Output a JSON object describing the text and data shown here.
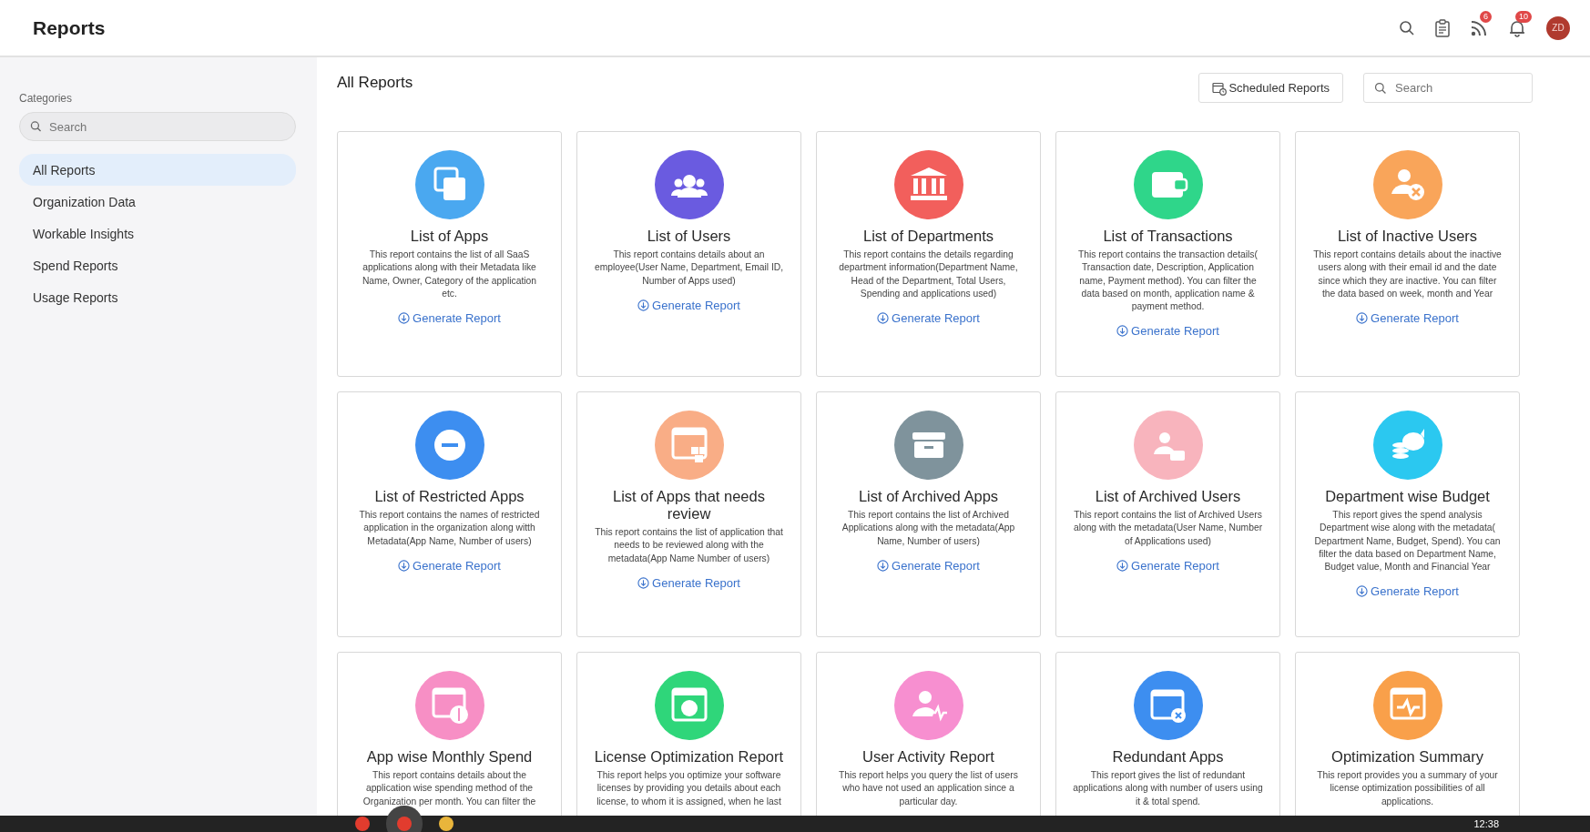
{
  "header": {
    "title": "Reports",
    "feed_badge": "6",
    "notifications_badge": "10",
    "avatar": "ZD"
  },
  "sidebar": {
    "heading": "Categories",
    "search": {
      "placeholder": "Search"
    },
    "items": [
      {
        "label": "All Reports",
        "selected": true
      },
      {
        "label": "Organization Data",
        "selected": false
      },
      {
        "label": "Workable Insights",
        "selected": false
      },
      {
        "label": "Spend Reports",
        "selected": false
      },
      {
        "label": "Usage Reports",
        "selected": false
      }
    ]
  },
  "main": {
    "title": "All Reports",
    "scheduled_button": "Scheduled Reports",
    "search": {
      "placeholder": "Search"
    },
    "cards": [
      {
        "title": "List of Apps",
        "color": "#4aa8f0",
        "description": "This report contains the list of all SaaS applications along with their Metadata like Name, Owner, Category of the application etc.",
        "action": "Generate Report"
      },
      {
        "title": "List of Users",
        "color": "#6a5be0",
        "description": "This report contains details about an employee(User Name, Department, Email ID, Number of Apps used)",
        "action": "Generate Report"
      },
      {
        "title": "List of Departments",
        "color": "#f25f5c",
        "description": "This report contains the details regarding department information(Department Name, Head of the Department, Total Users, Spending and applications used)",
        "action": "Generate Report"
      },
      {
        "title": "List of Transactions",
        "color": "#2fd68a",
        "description": "This report contains the transaction details( Transaction date, Description, Application name, Payment method). You can filter the data based on month, application name & payment method.",
        "action": "Generate Report"
      },
      {
        "title": "List of Inactive Users",
        "color": "#f9a55a",
        "description": "This report contains details about the inactive users along with their email id and the date since which they are inactive. You can filter the data based on week, month and Year",
        "action": "Generate Report"
      },
      {
        "title": "List of Restricted Apps",
        "color": "#3d8ef0",
        "description": "This report contains the names of restricted application in the organization along witth Metadata(App Name, Number of users)",
        "action": "Generate Report"
      },
      {
        "title": "List of Apps that needs review",
        "color": "#f9ad86",
        "description": "This report contains the list of application that needs to be reviewed along with the metadata(App Name Number of users)",
        "action": "Generate Report"
      },
      {
        "title": "List of Archived Apps",
        "color": "#7f939c",
        "description": "This report contains the list of Archived Applications along with the metadata(App Name, Number of users)",
        "action": "Generate Report"
      },
      {
        "title": "List of Archived Users",
        "color": "#f8b4bd",
        "description": "This report contains the list of Archived Users along with the metadata(User Name, Number of Applications used)",
        "action": "Generate Report"
      },
      {
        "title": "Department wise Budget",
        "color": "#2bc8f0",
        "description": "This report gives the spend analysis Department wise along with the metadata( Department Name, Budget, Spend). You can filter the data based on Department Name, Budget value, Month and Financial Year",
        "action": "Generate Report"
      },
      {
        "title": "App wise Monthly Spend",
        "color": "#f78fc5",
        "description": "This report contains details about the application wise spending method of the Organization per month. You can filter the"
      },
      {
        "title": "License Optimization Report",
        "color": "#2fd67a",
        "description": "This report helps you optimize your software licenses by providing you details about each license, to whom it is assigned, when he last"
      },
      {
        "title": "User Activity Report",
        "color": "#f78fd0",
        "description": "This report helps you query the list of users who have not used an application since a particular day."
      },
      {
        "title": "Redundant Apps",
        "color": "#3d8ef0",
        "description": "This report gives the list of redundant applications along with number of users using it & total spend."
      },
      {
        "title": "Optimization Summary",
        "color": "#f9a04a",
        "description": "This report provides you a summary of your license optimization possibilities of all applications."
      }
    ]
  },
  "taskbar": {
    "time": "12:38"
  }
}
